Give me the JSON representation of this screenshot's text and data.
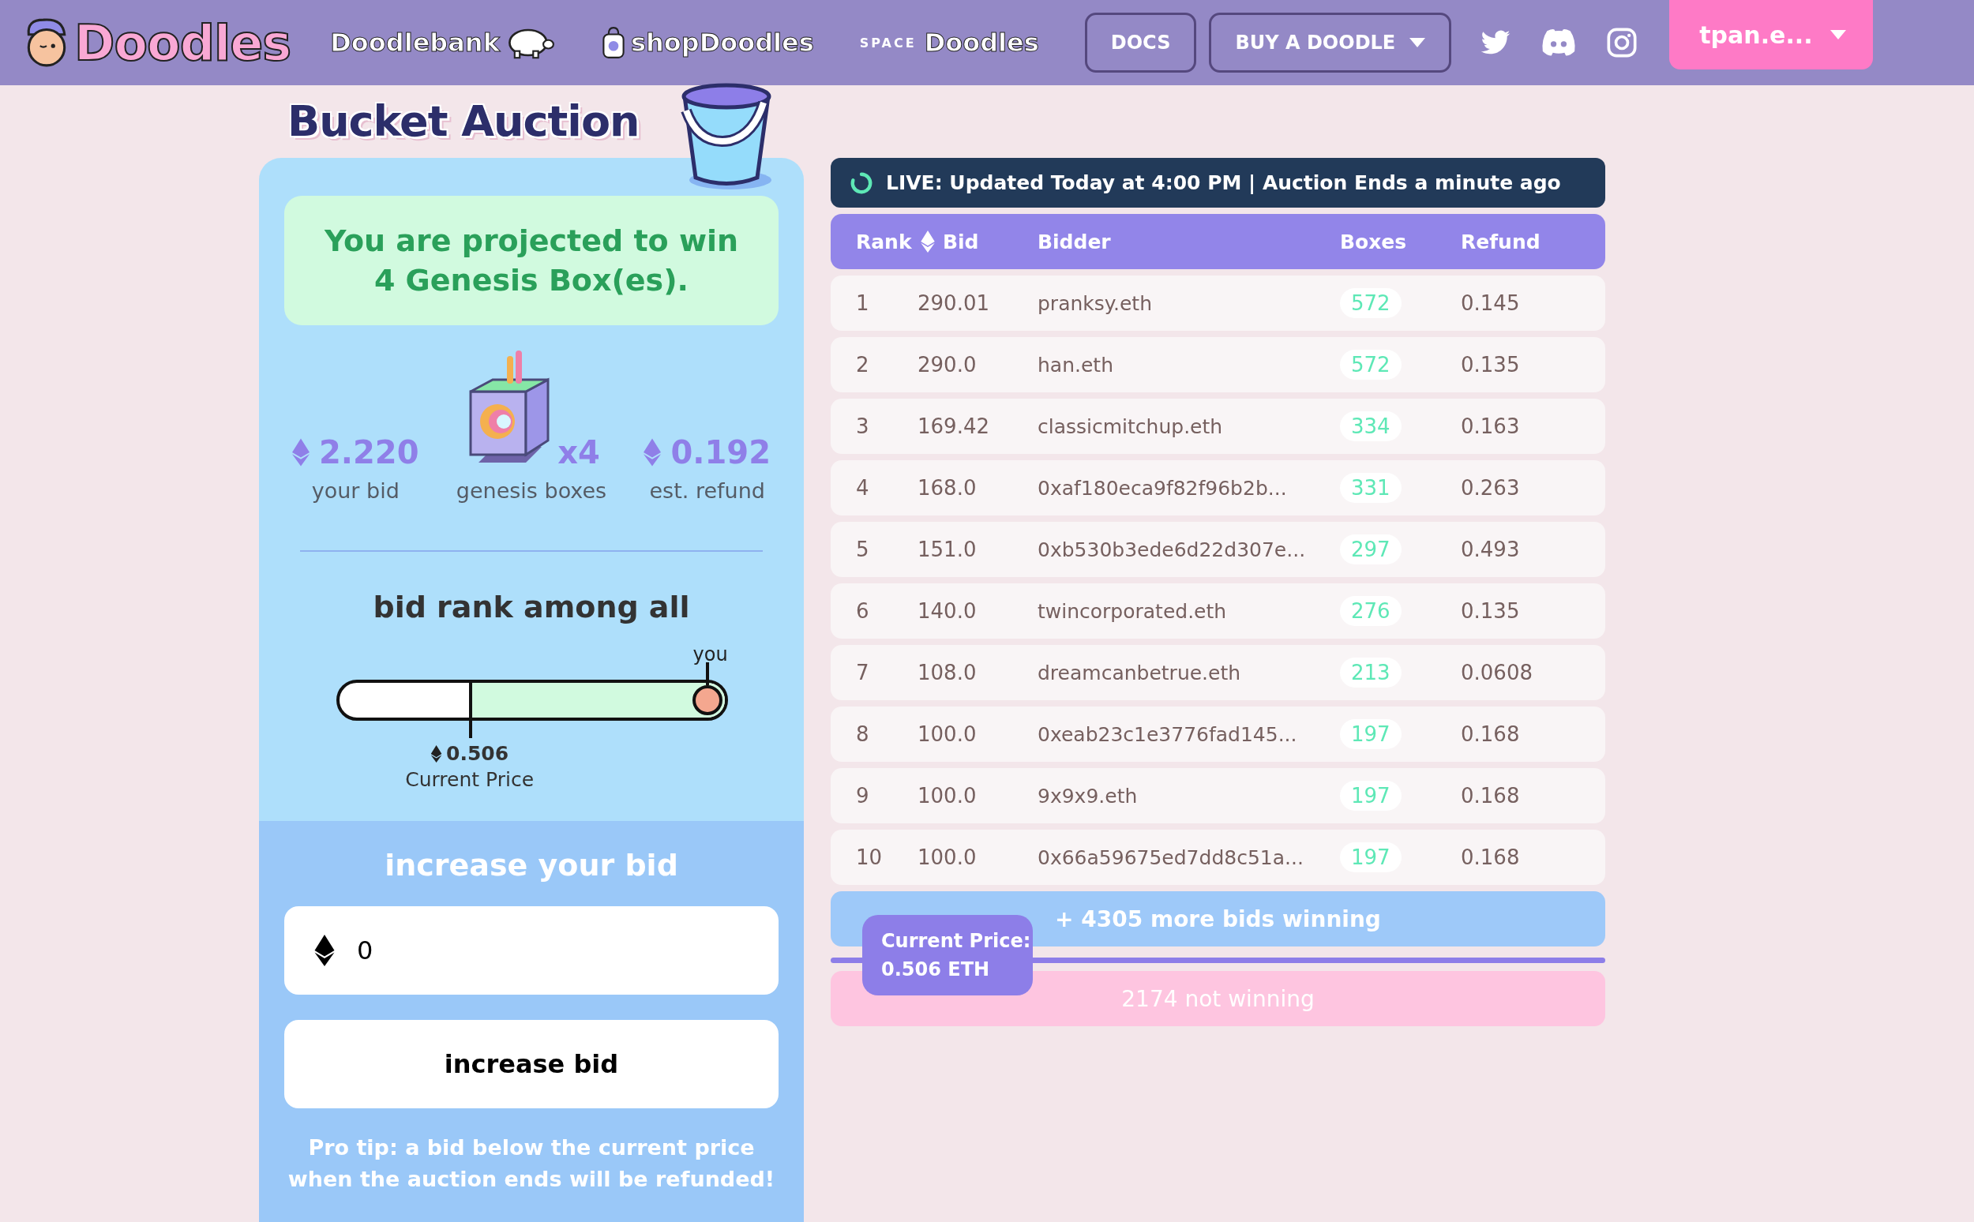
{
  "header": {
    "logo": "Doodles",
    "links": [
      {
        "kind": "bank",
        "label": "Doodlebank"
      },
      {
        "kind": "shop",
        "label": "shopDoodles"
      },
      {
        "kind": "space",
        "prefix": "SPACE",
        "label": "Doodles"
      }
    ],
    "buttons": [
      {
        "label": "DOCS",
        "dropdown": false
      },
      {
        "label": "BUY A DOODLE",
        "dropdown": true
      }
    ],
    "account": "tpan.e..."
  },
  "title": "Bucket Auction",
  "panel": {
    "projection": "You are projected to win 4 Genesis Box(es).",
    "stats": [
      {
        "kind": "eth",
        "value": "2.220",
        "label": "your bid"
      },
      {
        "kind": "boxes",
        "value": "x4",
        "label": "genesis boxes"
      },
      {
        "kind": "eth",
        "value": "0.192",
        "label": "est. refund"
      }
    ],
    "rank_title": "bid rank among all",
    "markers": [
      {
        "kind": "you",
        "label": "you",
        "level": 0.955
      },
      {
        "kind": "price",
        "value": "0.506",
        "label": "Current Price",
        "level": 0.34
      }
    ],
    "increase_title": "increase your bid",
    "input_value": "0",
    "button": "increase bid",
    "tip": "Pro tip: a bid below the current price when the auction ends will be refunded!"
  },
  "live": "LIVE: Updated Today at 4:00 PM | Auction Ends a minute ago",
  "table": {
    "columns": [
      "Rank",
      "Bid",
      "Bidder",
      "Boxes",
      "Refund"
    ],
    "rows": [
      [
        "1",
        "290.01",
        "pranksy.eth",
        "572",
        "0.145"
      ],
      [
        "2",
        "290.0",
        "han.eth",
        "572",
        "0.135"
      ],
      [
        "3",
        "169.42",
        "classicmitchup.eth",
        "334",
        "0.163"
      ],
      [
        "4",
        "168.0",
        "0xaf180eca9f82f96b2b...",
        "331",
        "0.263"
      ],
      [
        "5",
        "151.0",
        "0xb530b3ede6d22d307e...",
        "297",
        "0.493"
      ],
      [
        "6",
        "140.0",
        "twincorporated.eth",
        "276",
        "0.135"
      ],
      [
        "7",
        "108.0",
        "dreamcanbetrue.eth",
        "213",
        "0.0608"
      ],
      [
        "8",
        "100.0",
        "0xeab23c1e3776fad145...",
        "197",
        "0.168"
      ],
      [
        "9",
        "100.0",
        "9x9x9.eth",
        "197",
        "0.168"
      ],
      [
        "10",
        "100.0",
        "0x66a59675ed7dd8c51a...",
        "197",
        "0.168"
      ]
    ],
    "winning": "+ 4305 more bids winning",
    "losing": "2174 not winning",
    "price_tag": [
      "Current Price:",
      "0.506 ETH"
    ]
  }
}
